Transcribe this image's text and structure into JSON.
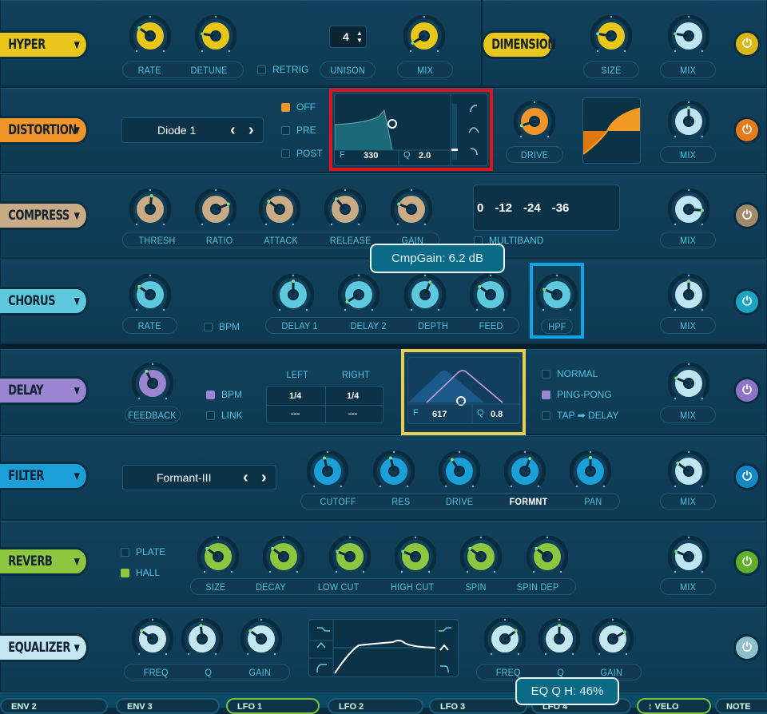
{
  "colors": {
    "hyper": "#e8c61a",
    "distortion": "#f0952a",
    "compress": "#c9ab85",
    "chorus": "#5ec8dc",
    "delay": "#9b85d0",
    "filter": "#1a9fd9",
    "reverb": "#8dc63f",
    "equalizer": "#c3e6ef",
    "mix": "#bfe5f2"
  },
  "hyper": {
    "title": "HYPER",
    "knobs": [
      {
        "label": "RATE",
        "value": 0.3
      },
      {
        "label": "DETUNE",
        "value": 0.2
      },
      {
        "label": "MIX",
        "value": 0.05
      }
    ],
    "retrig": "RETRIG",
    "unison_label": "UNISON",
    "unison_value": "4"
  },
  "dimension": {
    "title": "DIMENSION",
    "knobs": [
      {
        "label": "SIZE",
        "value": 0.2
      },
      {
        "label": "MIX",
        "value": 0.2
      }
    ]
  },
  "distortion": {
    "title": "DISTORTION",
    "mode": "Diode 1",
    "prev": "‹",
    "next": "›",
    "filter_opts": [
      {
        "label": "OFF",
        "checked": true
      },
      {
        "label": "PRE",
        "checked": false
      },
      {
        "label": "POST",
        "checked": false
      }
    ],
    "f_label": "F",
    "f_value": "330",
    "q_label": "Q",
    "q_value": "2.0",
    "knobs": [
      {
        "label": "DRIVE",
        "value": 0.1
      },
      {
        "label": "MIX",
        "value": 0.5
      }
    ]
  },
  "compress": {
    "title": "COMPRESS",
    "knobs": [
      {
        "label": "THRESH",
        "value": 0.52
      },
      {
        "label": "RATIO",
        "value": 0.75
      },
      {
        "label": "ATTACK",
        "value": 0.3
      },
      {
        "label": "RELEASE",
        "value": 0.35
      },
      {
        "label": "GAIN",
        "value": 0.25
      },
      {
        "label": "MIX",
        "value": 0.85
      }
    ],
    "meter": [
      "0",
      "-12",
      "-24",
      "-36"
    ],
    "multiband": "MULTIBAND"
  },
  "tooltip_comp": "CmpGain: 6.2 dB",
  "chorus": {
    "title": "CHORUS",
    "bpm": "BPM",
    "knobs": [
      {
        "label": "RATE",
        "value": 0.3
      },
      {
        "label": "DELAY 1",
        "value": 0.5
      },
      {
        "label": "DELAY 2",
        "value": 0.05
      },
      {
        "label": "DEPTH",
        "value": 0.58
      },
      {
        "label": "FEED",
        "value": 0.3
      },
      {
        "label": "HPF",
        "value": 0.25
      },
      {
        "label": "MIX",
        "value": 0.5
      }
    ]
  },
  "delay": {
    "title": "DELAY",
    "knobs": [
      {
        "label": "FEEDBACK",
        "value": 0.4
      },
      {
        "label": "MIX",
        "value": 0.25
      }
    ],
    "bpm": {
      "label": "BPM",
      "checked": true
    },
    "link": {
      "label": "LINK",
      "checked": false
    },
    "left": "LEFT",
    "right": "RIGHT",
    "left_val": "1/4",
    "right_val": "1/4",
    "left_off": "---",
    "right_off": "---",
    "f_label": "F",
    "f_value": "617",
    "q_label": "Q",
    "q_value": "0.8",
    "modes": [
      {
        "label": "NORMAL",
        "checked": false
      },
      {
        "label": "PING-PONG",
        "checked": true
      },
      {
        "label": "TAP ➡ DELAY",
        "checked": false
      }
    ]
  },
  "filter": {
    "title": "FILTER",
    "type": "Formant-III",
    "knobs": [
      {
        "label": "CUTOFF",
        "value": 0.45
      },
      {
        "label": "RES",
        "value": 0.45
      },
      {
        "label": "DRIVE",
        "value": 0.38
      },
      {
        "label": "FORMNT",
        "value": 0.58
      },
      {
        "label": "PAN",
        "value": 0.5
      },
      {
        "label": "MIX",
        "value": 0.3
      }
    ]
  },
  "reverb": {
    "title": "REVERB",
    "types": [
      {
        "label": "PLATE",
        "checked": false
      },
      {
        "label": "HALL",
        "checked": true
      }
    ],
    "knobs": [
      {
        "label": "SIZE",
        "value": 0.3
      },
      {
        "label": "DECAY",
        "value": 0.3
      },
      {
        "label": "LOW CUT",
        "value": 0.25
      },
      {
        "label": "HIGH CUT",
        "value": 0.25
      },
      {
        "label": "SPIN",
        "value": 0.3
      },
      {
        "label": "SPIN DEP",
        "value": 0.3
      },
      {
        "label": "MIX",
        "value": 0.25
      }
    ]
  },
  "equalizer": {
    "title": "EQUALIZER",
    "knobs": [
      {
        "label": "FREQ",
        "value": 0.3
      },
      {
        "label": "Q",
        "value": 0.48
      },
      {
        "label": "GAIN",
        "value": 0.3
      },
      {
        "label": "FREQ",
        "value": 0.7
      },
      {
        "label": "Q",
        "value": 0.5
      },
      {
        "label": "GAIN",
        "value": 0.72
      }
    ]
  },
  "tooltip_eq": "EQ Q H: 46%",
  "mod_tabs": [
    "ENV 2",
    "ENV 3",
    "LFO 1",
    "LFO 2",
    "LFO 3",
    "LFO 4",
    "↕ VELO",
    "NOTE"
  ]
}
